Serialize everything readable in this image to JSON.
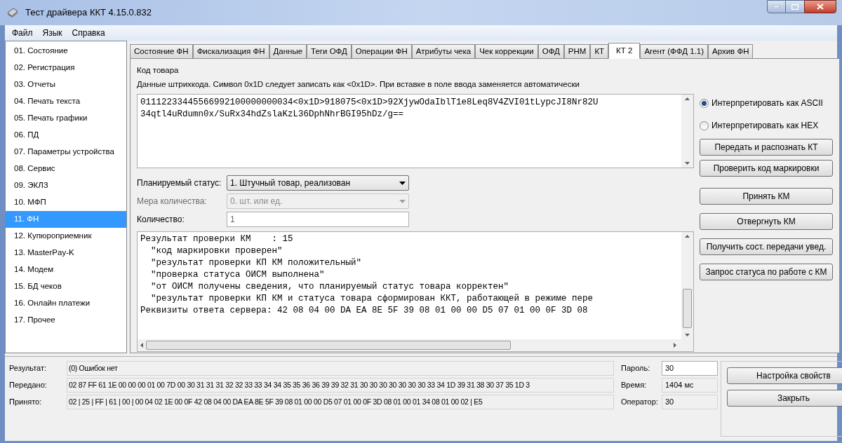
{
  "window": {
    "title": "Тест драйвера ККТ 4.15.0.832"
  },
  "menu": [
    "Файл",
    "Язык",
    "Справка"
  ],
  "sidebar": {
    "items": [
      {
        "label": "01. Состояние",
        "selected": false
      },
      {
        "label": "02. Регистрация",
        "selected": false
      },
      {
        "label": "03. Отчеты",
        "selected": false
      },
      {
        "label": "04. Печать текста",
        "selected": false
      },
      {
        "label": "05. Печать графики",
        "selected": false
      },
      {
        "label": "06. ПД",
        "selected": false
      },
      {
        "label": "07. Параметры устройства",
        "selected": false
      },
      {
        "label": "08. Сервис",
        "selected": false
      },
      {
        "label": "09. ЭКЛЗ",
        "selected": false
      },
      {
        "label": "10. МФП",
        "selected": false
      },
      {
        "label": "11. ФН",
        "selected": true
      },
      {
        "label": "12. Купюроприемник",
        "selected": false
      },
      {
        "label": "13. MasterPay-K",
        "selected": false
      },
      {
        "label": "14. Модем",
        "selected": false
      },
      {
        "label": "15. БД чеков",
        "selected": false
      },
      {
        "label": "16. Онлайн платежи",
        "selected": false
      },
      {
        "label": "17. Прочее",
        "selected": false
      }
    ]
  },
  "tabs": [
    {
      "label": "Состояние ФН",
      "selected": false
    },
    {
      "label": "Фискализация ФН",
      "selected": false
    },
    {
      "label": "Данные",
      "selected": false
    },
    {
      "label": "Теги ОФД",
      "selected": false
    },
    {
      "label": "Операции ФН",
      "selected": false
    },
    {
      "label": "Атрибуты чека",
      "selected": false
    },
    {
      "label": "Чек коррекции",
      "selected": false
    },
    {
      "label": "ОФД",
      "selected": false
    },
    {
      "label": "РНМ",
      "selected": false
    },
    {
      "label": "КТ",
      "selected": false
    },
    {
      "label": "КТ 2",
      "selected": true
    },
    {
      "label": "Агент (ФФД 1.1)",
      "selected": false
    },
    {
      "label": "Архив ФН",
      "selected": false
    }
  ],
  "panel": {
    "heading": "Код товара",
    "hint": "Данные штрихкода. Символ 0x1D следует записать как <0x1D>. При вставке в поле ввода заменяется автоматически",
    "barcode_lines": [
      "01112233445566992100000000034<0x1D>918075<0x1D>92XjywOdaIblT1e8Leq8V4ZVI01tLypcJI8Nr82U",
      "34qtl4uRdumn0x/SuRx34hdZslaKzL36DphNhrBGI95hDz/g=="
    ],
    "radios": [
      {
        "label": "Интерпретировать как ASCII",
        "selected": true
      },
      {
        "label": "Интерпретировать как HEX",
        "selected": false
      }
    ],
    "fields": [
      {
        "kind": "dropdown",
        "label": "Планируемый статус:",
        "value": "1. Штучный товар, реализован",
        "disabled": false
      },
      {
        "kind": "dropdown",
        "label": "Мера количества:",
        "value": "0. шт. или ед.",
        "disabled": true
      },
      {
        "kind": "text",
        "label": "Количество:",
        "value": "1",
        "disabled": false
      }
    ],
    "result_lines": [
      "Результат проверки КМ    : 15",
      "  \"код маркировки проверен\"",
      "  \"результат проверки КП КМ положительный\"",
      "  \"проверка статуса ОИСМ выполнена\"",
      "  \"от ОИСМ получены сведения, что планируемый статус товара корректен\"",
      "  \"результат проверки КП КМ и статуса товара сформирован ККТ, работающей в режиме пере",
      "Реквизиты ответа сервера: 42 08 04 00 DA EA 8E 5F 39 08 01 00 00 D5 07 01 00 0F 3D 08"
    ],
    "buttons_top": [
      "Передать и распознать КТ",
      "Проверить код маркировки"
    ],
    "buttons": [
      "Принять КМ",
      "Отвергнуть КМ",
      "Получить сост. передачи увед.",
      "Запрос статуса по работе с КМ"
    ]
  },
  "status": {
    "rows": [
      {
        "label": "Результат:",
        "value": "(0) Ошибок нет"
      },
      {
        "label": "Передано:",
        "value": "02 87 FF 61 1E 00 00 00 01 00 7D 00 30 31 31 31 32 32 33 33 34 34 35 35 36 36 39 39 32 31 30 30 30 30 30 30 30 33 34 1D 39 31 38 30 37 35 1D 3"
      },
      {
        "label": "Принято:",
        "value": "02 | 25 | FF | 61 | 00 | 00 04 02 1E 00 0F 42 08 04 00 DA EA 8E 5F 39 08 01 00 00 D5 07 01 00 0F 3D 08 01 00 01 34 08 01 00 02 | E5"
      }
    ],
    "side": [
      {
        "kind": "input",
        "label": "Пароль:",
        "value": "30"
      },
      {
        "kind": "readonly",
        "label": "Время:",
        "value": "1404 мс"
      },
      {
        "kind": "readonly",
        "label": "Оператор:",
        "value": "30"
      }
    ],
    "buttons": [
      "Настройка свойств",
      "Закрыть"
    ]
  }
}
